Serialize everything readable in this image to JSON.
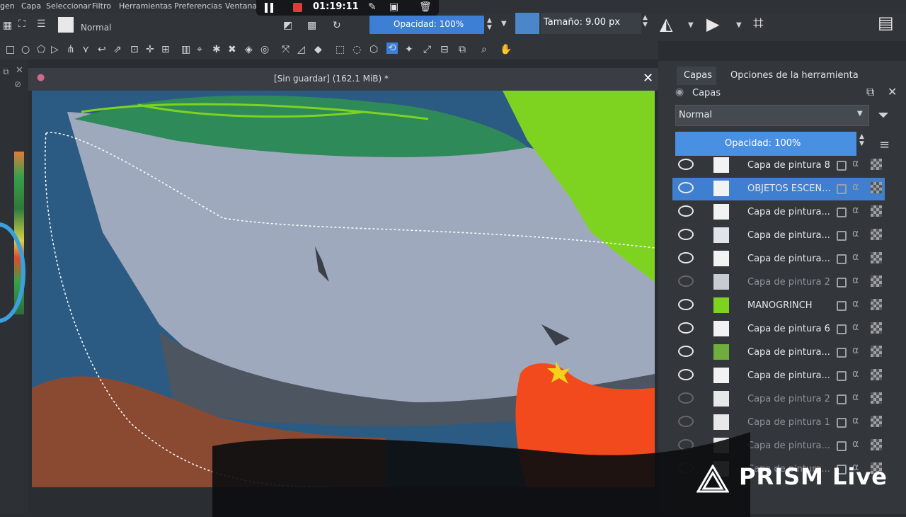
{
  "menu": [
    "gen",
    "Capa",
    "Seleccionar",
    "Filtro",
    "Herramientas",
    "Preferencias",
    "Ventana"
  ],
  "recorder": {
    "time": "01:19:11",
    "pause_icon": "pause-icon",
    "stop_icon": "stop-icon"
  },
  "toolbar": {
    "blend_mode": "Normal",
    "opacity_label": "Opacidad: 100%",
    "size_label": "Tamaño: 9.00 px"
  },
  "document": {
    "title": "[Sin guardar]  (162.1 MiB) *",
    "close": "✕"
  },
  "docker": {
    "tabs": [
      "Capas",
      "Opciones de la herramienta"
    ],
    "title": "Capas",
    "blend": "Normal",
    "opacity": "Opacidad:  100%",
    "layers": [
      {
        "name": "Capa de pintura 8",
        "visible": true,
        "selected": false,
        "thumb": "#f2f2f2"
      },
      {
        "name": "OBJETOS ESCEN...",
        "visible": true,
        "selected": true,
        "thumb": "#f2f2f2"
      },
      {
        "name": "Capa de pintura...",
        "visible": true,
        "selected": false,
        "thumb": "#f2f2f2"
      },
      {
        "name": "Capa de pintura...",
        "visible": true,
        "selected": false,
        "thumb": "#e0e4ea"
      },
      {
        "name": "Capa de pintura...",
        "visible": true,
        "selected": false,
        "thumb": "#f2f2f2"
      },
      {
        "name": "Capa de pintura 2",
        "visible": false,
        "selected": false,
        "thumb": "#c8ccd2"
      },
      {
        "name": "MANOGRINCH",
        "visible": true,
        "selected": false,
        "thumb": "#7ed321"
      },
      {
        "name": "Capa de pintura 6",
        "visible": true,
        "selected": false,
        "thumb": "#f2f2f2"
      },
      {
        "name": "Capa de pintura...",
        "visible": true,
        "selected": false,
        "thumb": "#6fae3c"
      },
      {
        "name": "Capa de pintura...",
        "visible": true,
        "selected": false,
        "thumb": "#f2f2f2"
      },
      {
        "name": "Capa de pintura 2",
        "visible": false,
        "selected": false,
        "thumb": "#e8e8e8"
      },
      {
        "name": "Capa de pintura 1",
        "visible": false,
        "selected": false,
        "thumb": "#e8e8e8"
      },
      {
        "name": "Capa de pintura...",
        "visible": false,
        "selected": false,
        "thumb": "#e8e8e8"
      },
      {
        "name": "Capa de pintura...",
        "visible": false,
        "selected": false,
        "thumb": "#e8e8e8"
      }
    ]
  },
  "watermark": {
    "text": "PRISM Live"
  },
  "colors": {
    "accent": "#4a90e2",
    "selected": "#3f7fd0",
    "canvas_gray": "#9da6b8",
    "green": "#7ed321",
    "orange": "#f24a1c"
  }
}
